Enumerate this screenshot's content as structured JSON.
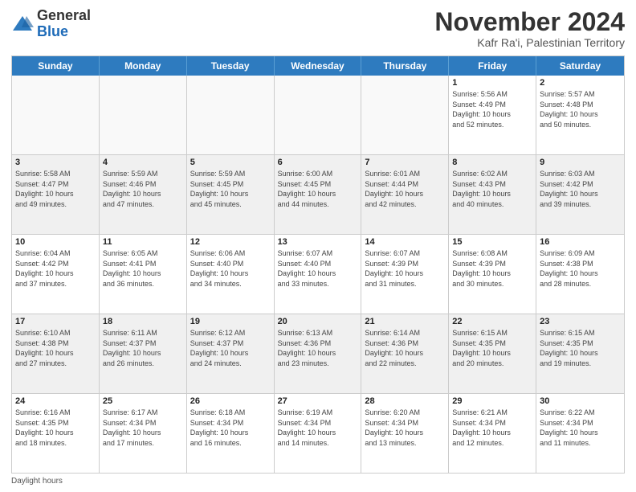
{
  "logo": {
    "general": "General",
    "blue": "Blue"
  },
  "title": "November 2024",
  "subtitle": "Kafr Ra'i, Palestinian Territory",
  "days_of_week": [
    "Sunday",
    "Monday",
    "Tuesday",
    "Wednesday",
    "Thursday",
    "Friday",
    "Saturday"
  ],
  "footer": "Daylight hours",
  "weeks": [
    [
      {
        "day": "",
        "info": ""
      },
      {
        "day": "",
        "info": ""
      },
      {
        "day": "",
        "info": ""
      },
      {
        "day": "",
        "info": ""
      },
      {
        "day": "",
        "info": ""
      },
      {
        "day": "1",
        "info": "Sunrise: 5:56 AM\nSunset: 4:49 PM\nDaylight: 10 hours\nand 52 minutes."
      },
      {
        "day": "2",
        "info": "Sunrise: 5:57 AM\nSunset: 4:48 PM\nDaylight: 10 hours\nand 50 minutes."
      }
    ],
    [
      {
        "day": "3",
        "info": "Sunrise: 5:58 AM\nSunset: 4:47 PM\nDaylight: 10 hours\nand 49 minutes."
      },
      {
        "day": "4",
        "info": "Sunrise: 5:59 AM\nSunset: 4:46 PM\nDaylight: 10 hours\nand 47 minutes."
      },
      {
        "day": "5",
        "info": "Sunrise: 5:59 AM\nSunset: 4:45 PM\nDaylight: 10 hours\nand 45 minutes."
      },
      {
        "day": "6",
        "info": "Sunrise: 6:00 AM\nSunset: 4:45 PM\nDaylight: 10 hours\nand 44 minutes."
      },
      {
        "day": "7",
        "info": "Sunrise: 6:01 AM\nSunset: 4:44 PM\nDaylight: 10 hours\nand 42 minutes."
      },
      {
        "day": "8",
        "info": "Sunrise: 6:02 AM\nSunset: 4:43 PM\nDaylight: 10 hours\nand 40 minutes."
      },
      {
        "day": "9",
        "info": "Sunrise: 6:03 AM\nSunset: 4:42 PM\nDaylight: 10 hours\nand 39 minutes."
      }
    ],
    [
      {
        "day": "10",
        "info": "Sunrise: 6:04 AM\nSunset: 4:42 PM\nDaylight: 10 hours\nand 37 minutes."
      },
      {
        "day": "11",
        "info": "Sunrise: 6:05 AM\nSunset: 4:41 PM\nDaylight: 10 hours\nand 36 minutes."
      },
      {
        "day": "12",
        "info": "Sunrise: 6:06 AM\nSunset: 4:40 PM\nDaylight: 10 hours\nand 34 minutes."
      },
      {
        "day": "13",
        "info": "Sunrise: 6:07 AM\nSunset: 4:40 PM\nDaylight: 10 hours\nand 33 minutes."
      },
      {
        "day": "14",
        "info": "Sunrise: 6:07 AM\nSunset: 4:39 PM\nDaylight: 10 hours\nand 31 minutes."
      },
      {
        "day": "15",
        "info": "Sunrise: 6:08 AM\nSunset: 4:39 PM\nDaylight: 10 hours\nand 30 minutes."
      },
      {
        "day": "16",
        "info": "Sunrise: 6:09 AM\nSunset: 4:38 PM\nDaylight: 10 hours\nand 28 minutes."
      }
    ],
    [
      {
        "day": "17",
        "info": "Sunrise: 6:10 AM\nSunset: 4:38 PM\nDaylight: 10 hours\nand 27 minutes."
      },
      {
        "day": "18",
        "info": "Sunrise: 6:11 AM\nSunset: 4:37 PM\nDaylight: 10 hours\nand 26 minutes."
      },
      {
        "day": "19",
        "info": "Sunrise: 6:12 AM\nSunset: 4:37 PM\nDaylight: 10 hours\nand 24 minutes."
      },
      {
        "day": "20",
        "info": "Sunrise: 6:13 AM\nSunset: 4:36 PM\nDaylight: 10 hours\nand 23 minutes."
      },
      {
        "day": "21",
        "info": "Sunrise: 6:14 AM\nSunset: 4:36 PM\nDaylight: 10 hours\nand 22 minutes."
      },
      {
        "day": "22",
        "info": "Sunrise: 6:15 AM\nSunset: 4:35 PM\nDaylight: 10 hours\nand 20 minutes."
      },
      {
        "day": "23",
        "info": "Sunrise: 6:15 AM\nSunset: 4:35 PM\nDaylight: 10 hours\nand 19 minutes."
      }
    ],
    [
      {
        "day": "24",
        "info": "Sunrise: 6:16 AM\nSunset: 4:35 PM\nDaylight: 10 hours\nand 18 minutes."
      },
      {
        "day": "25",
        "info": "Sunrise: 6:17 AM\nSunset: 4:34 PM\nDaylight: 10 hours\nand 17 minutes."
      },
      {
        "day": "26",
        "info": "Sunrise: 6:18 AM\nSunset: 4:34 PM\nDaylight: 10 hours\nand 16 minutes."
      },
      {
        "day": "27",
        "info": "Sunrise: 6:19 AM\nSunset: 4:34 PM\nDaylight: 10 hours\nand 14 minutes."
      },
      {
        "day": "28",
        "info": "Sunrise: 6:20 AM\nSunset: 4:34 PM\nDaylight: 10 hours\nand 13 minutes."
      },
      {
        "day": "29",
        "info": "Sunrise: 6:21 AM\nSunset: 4:34 PM\nDaylight: 10 hours\nand 12 minutes."
      },
      {
        "day": "30",
        "info": "Sunrise: 6:22 AM\nSunset: 4:34 PM\nDaylight: 10 hours\nand 11 minutes."
      }
    ]
  ]
}
